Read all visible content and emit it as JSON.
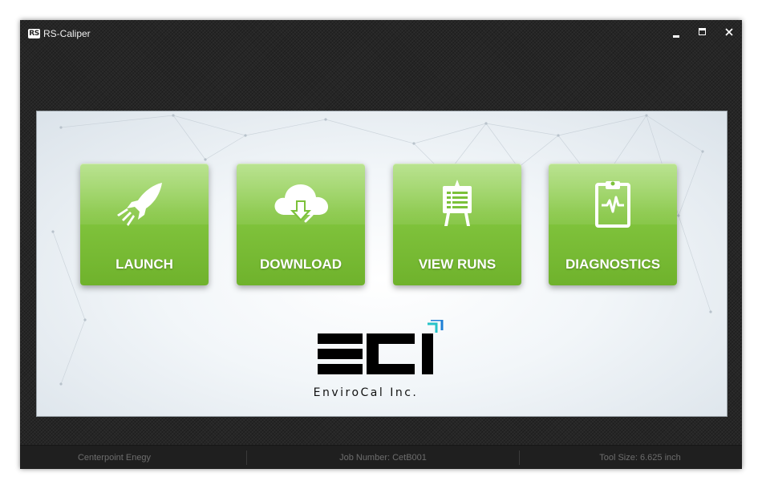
{
  "window": {
    "title": "RS-Caliper",
    "icon_text": "RS"
  },
  "tiles": [
    {
      "label": "LAUNCH",
      "icon": "rocket-icon"
    },
    {
      "label": "DOWNLOAD",
      "icon": "cloud-download-icon"
    },
    {
      "label": "VIEW RUNS",
      "icon": "easel-list-icon"
    },
    {
      "label": "DIAGNOSTICS",
      "icon": "clipboard-pulse-icon"
    }
  ],
  "brand": {
    "logo": "ECI",
    "name": "EnviroCal Inc."
  },
  "status": {
    "company": "Centerpoint Enegy",
    "job_number": "Job Number: CetB001",
    "tool_size": "Tool Size: 6.625 inch"
  },
  "colors": {
    "tile_green": "#7cc13a",
    "logo_teal": "#27c3c8",
    "logo_blue": "#1e7fd6"
  }
}
